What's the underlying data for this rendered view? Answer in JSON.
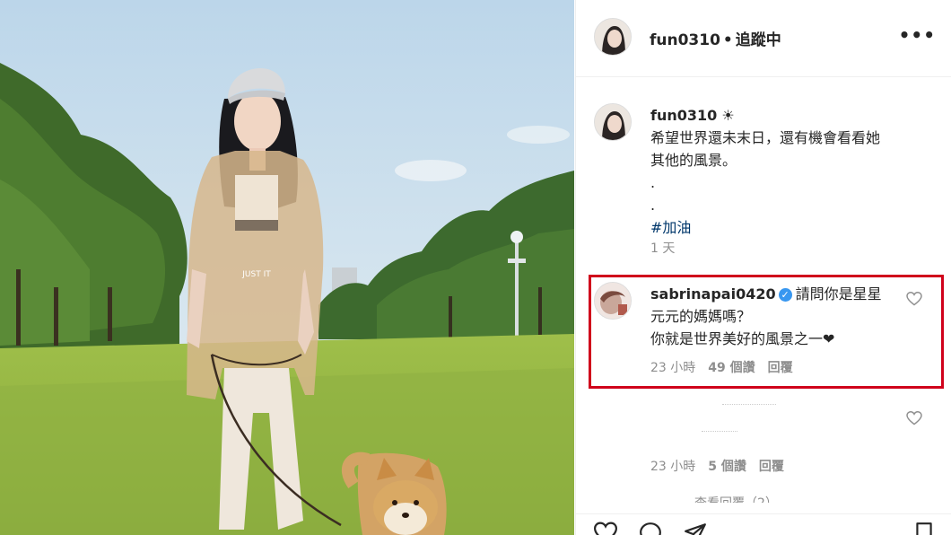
{
  "header": {
    "username": "fun0310",
    "separator": "•",
    "follow_status": "追蹤中",
    "more_label": "•••"
  },
  "caption": {
    "username": "fun0310",
    "emoji": "☀",
    "line1": "希望世界還未末日，還有機會看看她",
    "line2": "其他的風景。",
    "line3": ".",
    "line4": ".",
    "hashtag": "#加油",
    "time": "1 天"
  },
  "comment": {
    "username": "sabrinapai0420",
    "verified_glyph": "✓",
    "text_a": "請問你是星星",
    "text_b": "元元的媽媽嗎？",
    "text_c": "你就是世界美好的風景之一❤",
    "time": "23 小時",
    "likes": "49 個讚",
    "reply": "回覆"
  },
  "comment2": {
    "time": "23 小時",
    "likes": "5 個讚",
    "reply": "回覆",
    "view_replies": "查看回覆（2）"
  },
  "photo": {
    "shirt_text_1": "JUST IT"
  },
  "colors": {
    "highlight_border": "#d0021b",
    "link": "#00376b",
    "meta": "#8e8e8e",
    "verified": "#3897f0"
  },
  "icons": [
    "more-icon",
    "verified-icon",
    "heart-icon",
    "comment-icon",
    "share-icon",
    "bookmark-icon"
  ]
}
